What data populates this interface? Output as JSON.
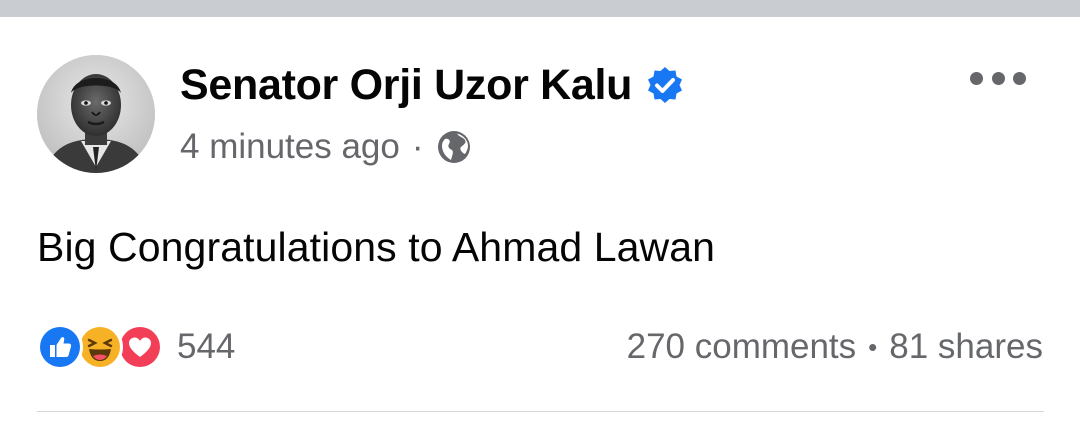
{
  "post": {
    "author": "Senator Orji Uzor Kalu",
    "timestamp": "4 minutes ago",
    "separator": "·",
    "privacy_icon": "globe-icon",
    "text": "Big Congratulations to Ahmad Lawan",
    "reactions": {
      "types": [
        "like",
        "haha",
        "love"
      ],
      "count": "544"
    },
    "comments": "270 comments",
    "stats_separator": "•",
    "shares": "81 shares"
  },
  "colors": {
    "like_blue": "#1877f2",
    "love_red": "#f33e58",
    "haha_yellow": "#f7b125",
    "verified_blue": "#1877f2",
    "secondary_text": "#65676b"
  }
}
